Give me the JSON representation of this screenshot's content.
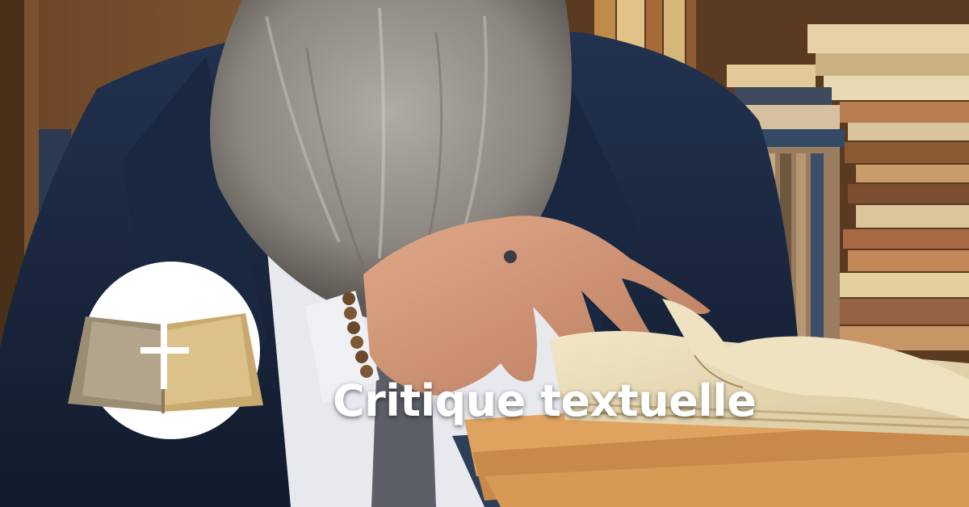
{
  "banner": {
    "title": "Critique textuelle"
  },
  "photo": {
    "subject": "bearded-man-reading-open-book"
  },
  "logo": {
    "icon": "open-bible-with-cross"
  },
  "colors": {
    "title_text": "#ffffff",
    "logo_circle": "#ffffff",
    "logo_page_light": "#dcc18a",
    "logo_page_dark": "#b3a48c",
    "logo_cross": "#ffffff",
    "suit": "#1c2a42",
    "beard": "#9a9590",
    "shelf_wood": "#6b4a2a"
  }
}
